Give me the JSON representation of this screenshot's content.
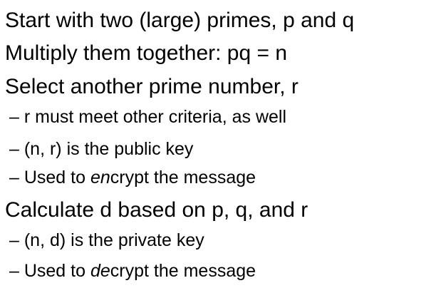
{
  "bullets": [
    {
      "text": "Start with two (large) primes, p and q"
    },
    {
      "text": "Multiply them together: pq = n"
    },
    {
      "text": "Select another prime number, r"
    },
    {
      "text": "– r must meet other criteria, as well"
    },
    {
      "text": "– (n, r) is the public key"
    },
    {
      "prefix": "– Used to ",
      "emph": "en",
      "suffix": "crypt the message"
    },
    {
      "text": "Calculate d based on p, q, and r"
    },
    {
      "text": "– (n, d) is the private key"
    },
    {
      "prefix": "– Used to ",
      "emph": "de",
      "suffix": "crypt the message"
    }
  ]
}
